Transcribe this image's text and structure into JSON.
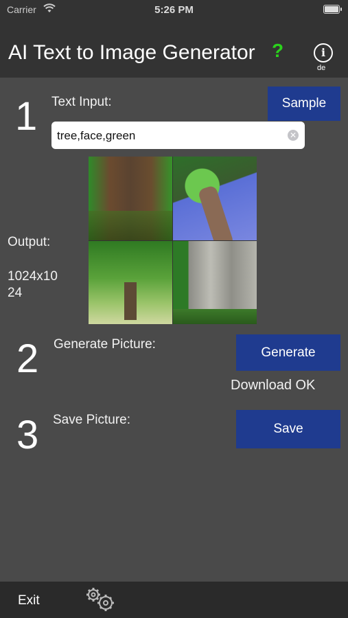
{
  "status": {
    "carrier": "Carrier",
    "time": "5:26 PM"
  },
  "header": {
    "title": "AI Text to Image Generator",
    "help": "?",
    "info": "i",
    "lang": "de"
  },
  "step1": {
    "number": "1",
    "label": "Text Input:",
    "sample_button": "Sample",
    "input_value": "tree,face,green"
  },
  "output": {
    "label": "Output:",
    "size_line1": "1024x10",
    "size_line2": "24"
  },
  "step2": {
    "number": "2",
    "label": "Generate Picture:",
    "button": "Generate",
    "status": "Download OK"
  },
  "step3": {
    "number": "3",
    "label": "Save Picture:",
    "button": "Save"
  },
  "footer": {
    "exit": "Exit",
    "settings_icon": "gears-icon"
  },
  "colors": {
    "button_bg": "#1f3b8f",
    "help_green": "#2bd21c",
    "background": "#4a4a4a",
    "header_bg": "#333333"
  }
}
